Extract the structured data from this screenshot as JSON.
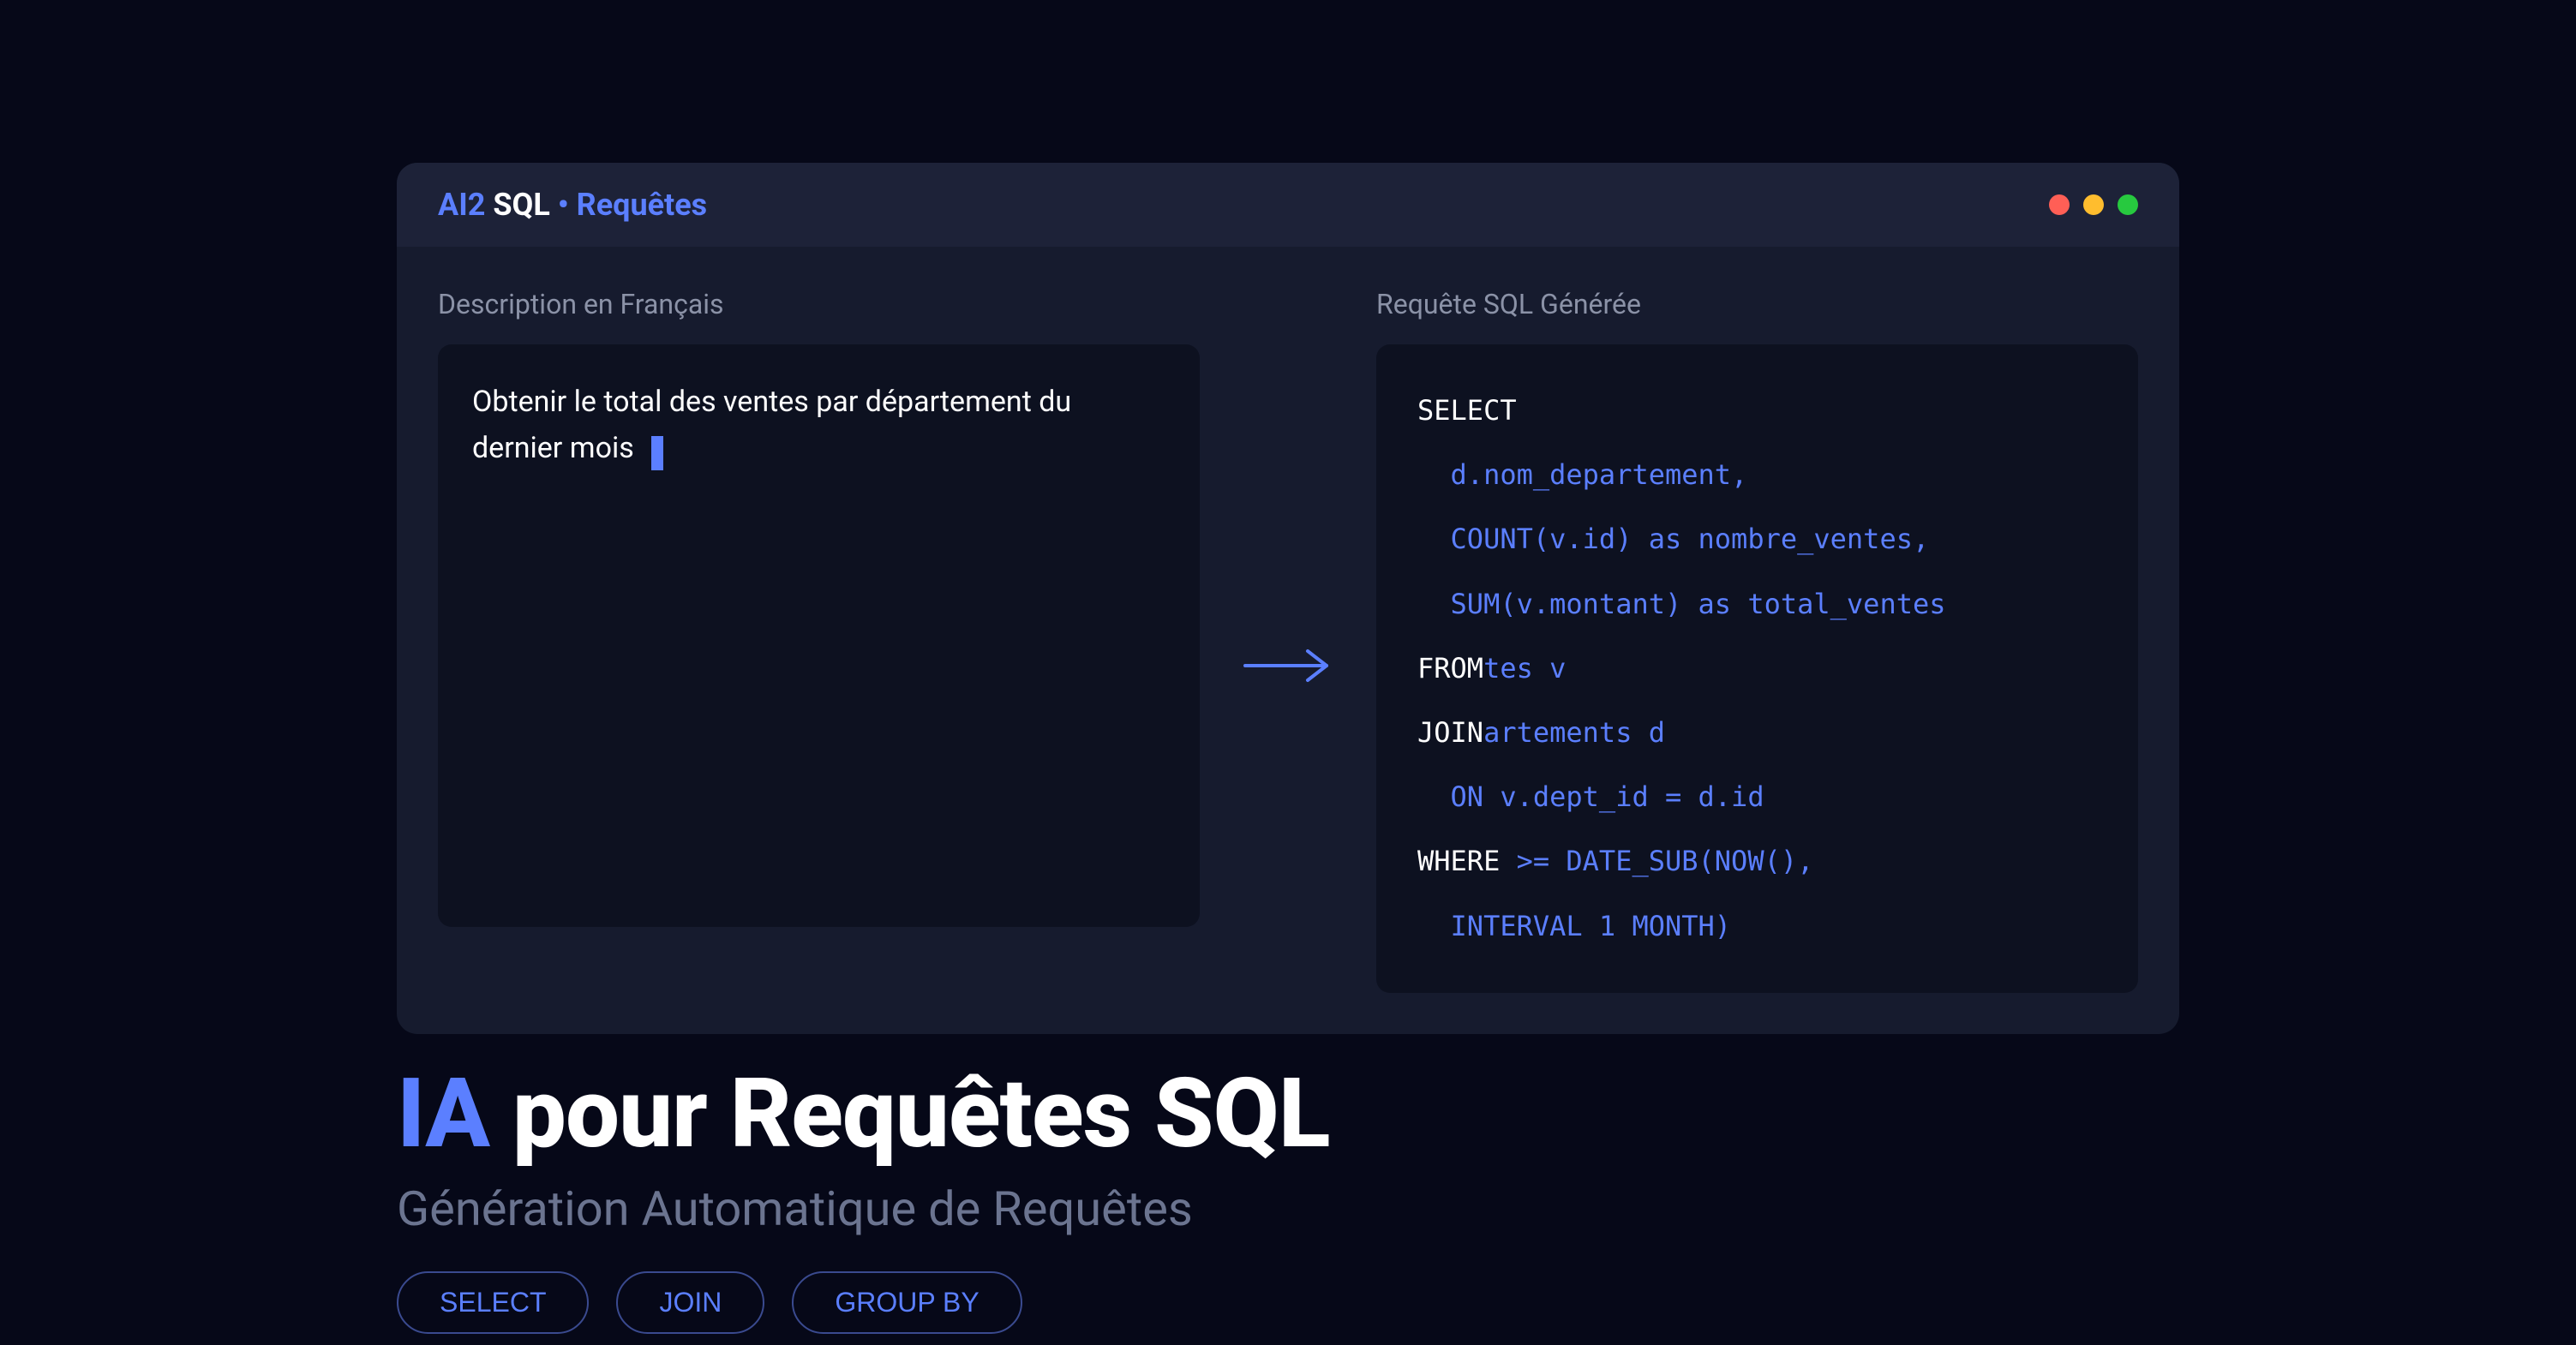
{
  "editor": {
    "title": {
      "part1": "AI2",
      "part2": "SQL",
      "bullet": "•",
      "part3": "Requêtes"
    },
    "input": {
      "label": "Description en Français",
      "text": "Obtenir le total des ventes par département du dernier mois"
    },
    "output": {
      "label": "Requête SQL Générée",
      "lines": [
        {
          "keyword": "SELECT",
          "rest": ""
        },
        {
          "keyword": "",
          "rest": "  d.nom_departement,"
        },
        {
          "keyword": "",
          "rest": "  COUNT(v.id) as nombre_ventes,"
        },
        {
          "keyword": "",
          "rest": "  SUM(v.montant) as total_ventes"
        },
        {
          "keyword": "FROM",
          "rest": " ventes v"
        },
        {
          "keyword": "JOIN",
          "rest": " departements d"
        },
        {
          "keyword": "",
          "rest": "  ON v.dept_id = d.id"
        },
        {
          "keyword": "WHERE",
          "rest": " date >= DATE_SUB(NOW(),"
        },
        {
          "keyword": "",
          "rest": "  INTERVAL 1 MONTH)"
        }
      ]
    }
  },
  "hero": {
    "title_accent": "IA",
    "title_rest": " pour Requêtes SQL",
    "subtitle": "Génération Automatique de Requêtes"
  },
  "chips": [
    "SELECT",
    "JOIN",
    "GROUP BY"
  ]
}
